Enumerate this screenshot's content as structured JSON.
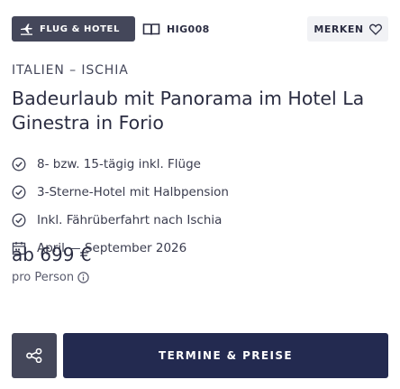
{
  "header": {
    "type_badge": "FLUG & HOTEL",
    "code": "HIG008",
    "remember_label": "MERKEN"
  },
  "offer": {
    "region": "ITALIEN – ISCHIA",
    "title": "Badeurlaub mit Panorama im Hotel La Ginestra in Forio",
    "features": [
      "8- bzw. 15-tägig inkl. Flüge",
      "3-Sterne-Hotel mit Halbpension",
      "Inkl. Fährüberfahrt nach Ischia"
    ],
    "travel_period": "April — September 2026",
    "price": "ab 699 €",
    "price_note": "pro Person"
  },
  "actions": {
    "cta_label": "TERMINE & PREISE"
  },
  "colors": {
    "badge_bg": "#44475a",
    "cta_bg": "#232a50",
    "remember_bg": "#f1f2f5",
    "text": "#2b2d42"
  },
  "icons": {
    "type_badge": "plane-hotel-icon",
    "code": "catalog-book-icon",
    "remember": "heart-icon",
    "feature": "check-circle-icon",
    "period": "calendar-icon",
    "price_info": "info-icon",
    "share": "share-icon"
  }
}
